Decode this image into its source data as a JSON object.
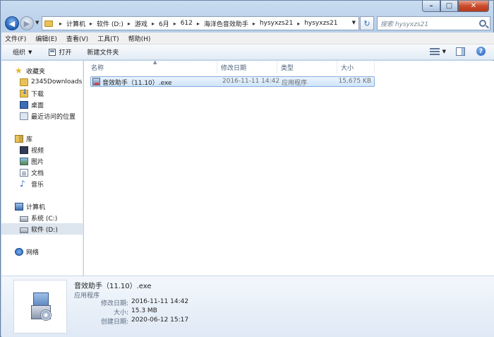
{
  "window": {
    "caption": {
      "minimize": "–",
      "maximize": "□",
      "close": "✕"
    }
  },
  "address": {
    "crumbs": [
      "计算机",
      "软件 (D:)",
      "游戏",
      "6月",
      "612",
      "海洋色音效助手",
      "hysyxzs21",
      "hysyxzs21"
    ],
    "search_placeholder": "搜索 hysyxzs21"
  },
  "menu": [
    "文件(F)",
    "编辑(E)",
    "查看(V)",
    "工具(T)",
    "帮助(H)"
  ],
  "toolbar": {
    "organize": "组织",
    "open": "打开",
    "new_folder": "新建文件夹"
  },
  "nav": {
    "favorites": {
      "label": "收藏夹",
      "items": [
        "2345Downloads",
        "下载",
        "桌面",
        "最近访问的位置"
      ]
    },
    "libraries": {
      "label": "库",
      "items": [
        "视频",
        "图片",
        "文档",
        "音乐"
      ]
    },
    "computer": {
      "label": "计算机",
      "items": [
        "系统 (C:)",
        "软件 (D:)"
      ]
    },
    "network": {
      "label": "网络"
    }
  },
  "columns": {
    "name": "名称",
    "modified": "修改日期",
    "type": "类型",
    "size": "大小"
  },
  "files": [
    {
      "name": "音效助手（11.10）.exe",
      "modified": "2016-11-11 14:42",
      "type": "应用程序",
      "size": "15,675 KB"
    }
  ],
  "details": {
    "name": "音效助手（11.10）.exe",
    "type": "应用程序",
    "modified_label": "修改日期:",
    "modified": "2016-11-11 14:42",
    "size_label": "大小:",
    "size": "15.3 MB",
    "created_label": "创建日期:",
    "created": "2020-06-12 15:17"
  }
}
